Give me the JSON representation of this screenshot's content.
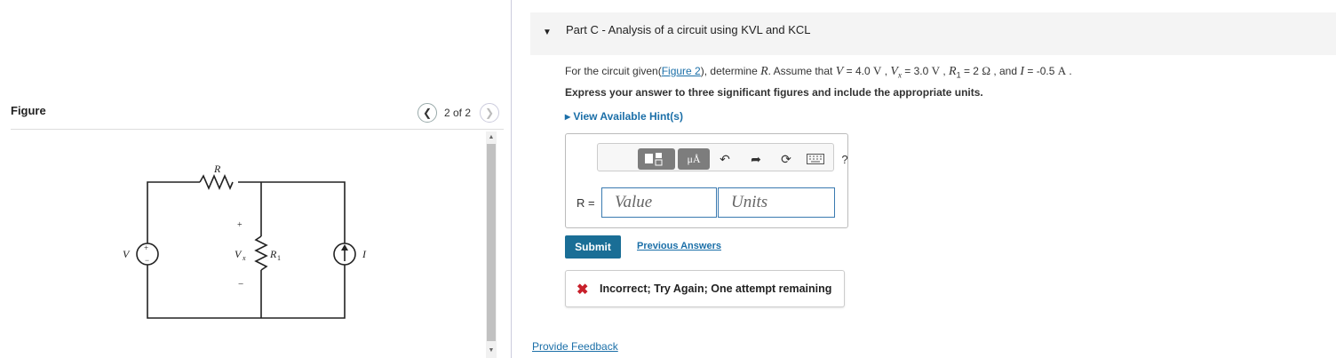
{
  "figure": {
    "label": "Figure",
    "page_count": "2 of 2",
    "prev_icon": "chevron-left-icon",
    "next_icon": "chevron-right-icon",
    "circuit": {
      "source_label": "V",
      "resistor_label": "R",
      "vx_label": "V",
      "vx_sub": "x",
      "r1_label": "R",
      "r1_sub": "1",
      "current_label": "I",
      "plus": "+",
      "minus": "−"
    }
  },
  "part": {
    "title": "Part C - Analysis of a circuit using KVL and KCL",
    "question_prefix": "For the circuit given(",
    "figure_link": "Figure 2",
    "question_mid": "), determine ",
    "R": "R",
    "assume": ". Assume that ",
    "V": "V",
    "v_val": " = 4.0 ",
    "V_unit": "V",
    "Vx": "V",
    "vx_sub": "x",
    "vx_val": " = 3.0 ",
    "R1": "R",
    "r1_sub": "1",
    "r1_val": " = 2 ",
    "ohm": "Ω",
    "and": " , and ",
    "I": "I",
    "i_val": " = -0.5 ",
    "A_unit": "A",
    "end": " .",
    "instruction": "Express your answer to three significant figures and include the appropriate units.",
    "hint": "View Available Hint(s)"
  },
  "answer": {
    "label": "R =",
    "value_placeholder": "Value",
    "units_placeholder": "Units",
    "units_button": "μÅ",
    "help": "?"
  },
  "actions": {
    "submit": "Submit",
    "previous_answers": "Previous Answers"
  },
  "feedback": {
    "icon": "x-icon",
    "message": "Incorrect; Try Again; One attempt remaining",
    "color": "#c8202b"
  },
  "footer": {
    "provide_feedback": "Provide Feedback"
  }
}
